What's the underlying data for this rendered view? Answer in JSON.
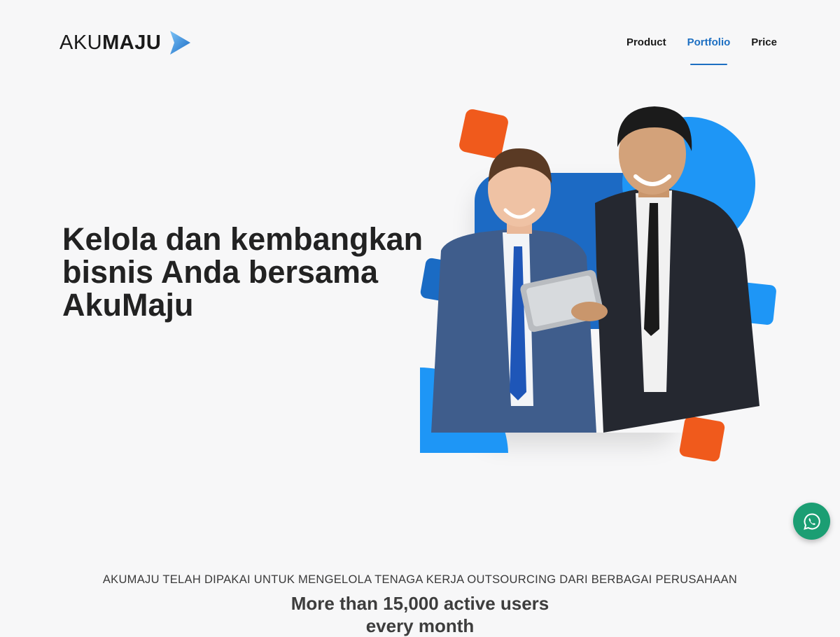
{
  "brand": {
    "name_light": "AKU",
    "name_bold": "MAJU",
    "accent": "#1d6fc2"
  },
  "nav": {
    "items": [
      {
        "label": "Product",
        "active": false
      },
      {
        "label": "Portfolio",
        "active": true
      },
      {
        "label": "Price",
        "active": false
      }
    ]
  },
  "hero": {
    "title": "Kelola dan kembangkan bisnis Anda bersama AkuMaju",
    "illustration_icon": "business-people-tablet-illustration"
  },
  "social_proof": {
    "subtitle": "AKUMAJU TELAH DIPAKAI UNTUK MENGELOLA TENAGA KERJA OUTSOURCING DARI BERBAGAI PERUSAHAAN",
    "headline_line1": "More than 15,000 active users",
    "headline_line2": "every month"
  },
  "chat_button": {
    "icon": "whatsapp-icon",
    "color": "#1b9e73"
  },
  "colors": {
    "blue": "#1e96f6",
    "dark_blue": "#1a6bc4",
    "orange": "#f05a1c"
  }
}
